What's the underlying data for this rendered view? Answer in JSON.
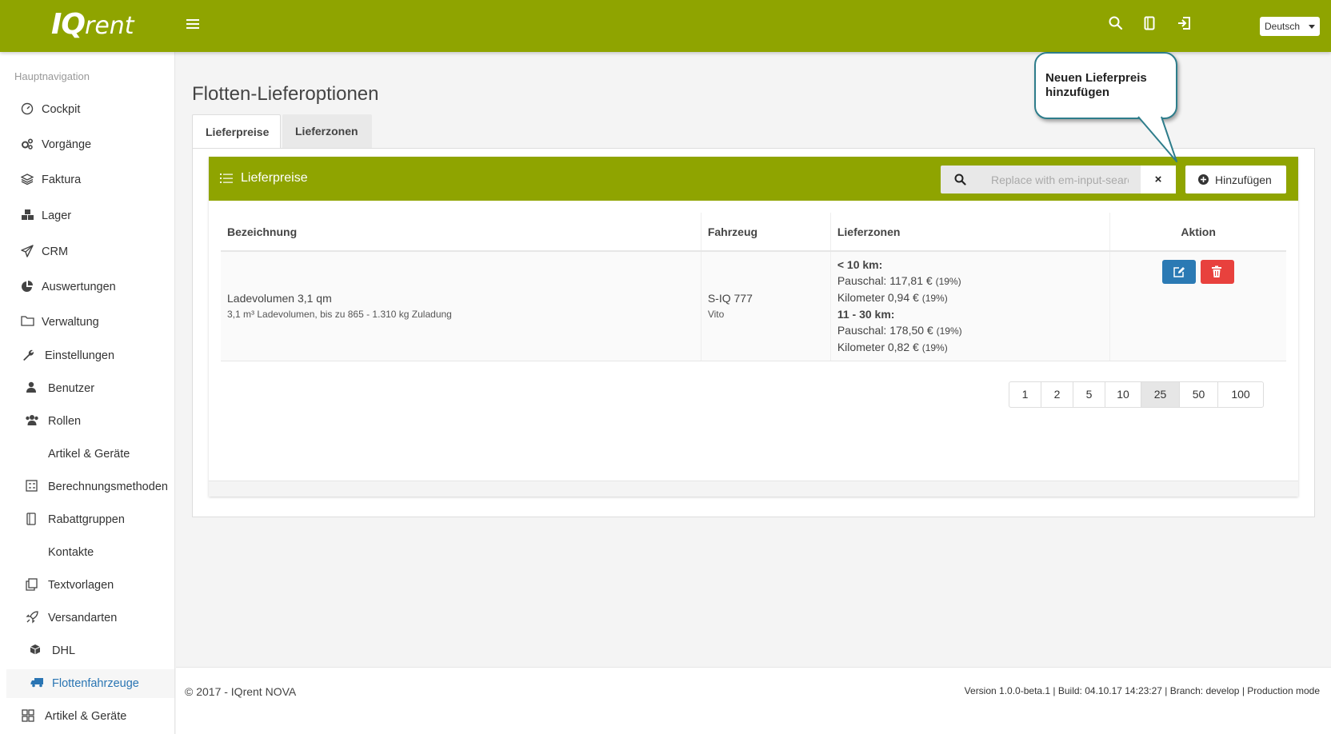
{
  "app": {
    "logo_main": "IQ",
    "logo_sub": "rent"
  },
  "topbar": {
    "language": "Deutsch"
  },
  "sidebar": {
    "header": "Hauptnavigation",
    "items": [
      {
        "label": "Cockpit",
        "icon": "gauge-icon"
      },
      {
        "label": "Vorgänge",
        "icon": "gears-icon"
      },
      {
        "label": "Faktura",
        "icon": "layers-icon"
      },
      {
        "label": "Lager",
        "icon": "cubes-icon"
      },
      {
        "label": "CRM",
        "icon": "paper-plane-icon"
      },
      {
        "label": "Auswertungen",
        "icon": "pie-chart-icon"
      },
      {
        "label": "Verwaltung",
        "icon": "folder-icon"
      },
      {
        "label": "Einstellungen",
        "icon": "wrench-icon"
      },
      {
        "label": "Benutzer",
        "icon": "user-icon"
      },
      {
        "label": "Rollen",
        "icon": "users-icon"
      },
      {
        "label": "Artikel & Geräte",
        "icon": ""
      },
      {
        "label": "Berechnungsmethoden",
        "icon": "calculator-icon"
      },
      {
        "label": "Rabattgruppen",
        "icon": "book-icon"
      },
      {
        "label": "Kontakte",
        "icon": ""
      },
      {
        "label": "Textvorlagen",
        "icon": "copy-icon"
      },
      {
        "label": "Versandarten",
        "icon": "rocket-icon"
      },
      {
        "label": "DHL",
        "icon": "cube-icon"
      },
      {
        "label": "Flottenfahrzeuge",
        "icon": "truck-icon",
        "active": true
      },
      {
        "label": "Artikel & Geräte",
        "icon": "grid-icon"
      }
    ]
  },
  "page": {
    "title": "Flotten-Lieferoptionen"
  },
  "tabs": [
    {
      "label": "Lieferpreise",
      "active": true
    },
    {
      "label": "Lieferzonen",
      "active": false
    }
  ],
  "box": {
    "title": "Lieferpreise",
    "search_placeholder": "Replace with em-input-search",
    "clear_label": "×",
    "add_label": "Hinzufügen"
  },
  "table": {
    "headers": [
      "Bezeichnung",
      "Fahrzeug",
      "Lieferzonen",
      "Aktion"
    ],
    "rows": [
      {
        "name": "Ladevolumen 3,1 qm",
        "description": "3,1 m³ Ladevolumen, bis zu 865 - 1.310 kg Zuladung",
        "vehicle": "S-IQ 777",
        "vehicle_model": "Vito",
        "zones": [
          {
            "name": "< 10 km:",
            "flat_label": "Pauschal:",
            "flat": "117,81 €",
            "flat_tax": "(19%)",
            "km_label": "Kilometer",
            "km": "0,94 €",
            "km_tax": "(19%)"
          },
          {
            "name": "11 - 30 km:",
            "flat_label": "Pauschal:",
            "flat": "178,50 €",
            "flat_tax": "(19%)",
            "km_label": "Kilometer",
            "km": "0,82 €",
            "km_tax": "(19%)"
          }
        ]
      }
    ]
  },
  "pagination": {
    "options": [
      "1",
      "2",
      "5",
      "10",
      "25",
      "50",
      "100"
    ],
    "active": "25"
  },
  "callout": {
    "text": "Neuen Lieferpreis hinzufügen"
  },
  "footer": {
    "copyright": "© 2017 - IQrent NOVA",
    "version": "Version 1.0.0-beta.1 | Build: 04.10.17 14:23:27 | Branch: develop | Production mode"
  },
  "colors": {
    "brand": "#8fa400",
    "edit": "#2b7ab4",
    "delete": "#e8413d",
    "callout_border": "#2e7d8b"
  }
}
